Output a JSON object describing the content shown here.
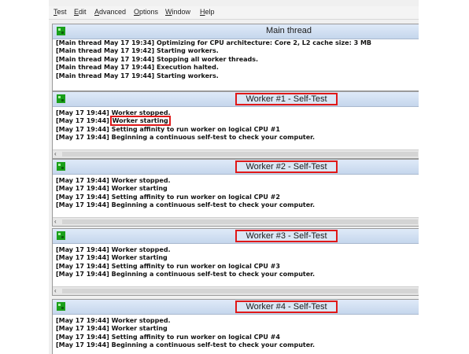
{
  "menu": [
    {
      "label": "Test",
      "mnemonic": "T",
      "rest": "est"
    },
    {
      "label": "Edit",
      "mnemonic": "E",
      "rest": "dit"
    },
    {
      "label": "Advanced",
      "mnemonic": "A",
      "rest": "dvanced"
    },
    {
      "label": "Options",
      "mnemonic": "O",
      "rest": "ptions"
    },
    {
      "label": "Window",
      "mnemonic": "W",
      "rest": "indow"
    },
    {
      "label": "Help",
      "mnemonic": "H",
      "rest": "elp"
    }
  ],
  "main_thread": {
    "title": "Main thread",
    "lines": [
      "[Main thread May 17 19:34] Optimizing for CPU architecture: Core 2, L2 cache size: 3 MB",
      "[Main thread May 17 19:42] Starting workers.",
      "[Main thread May 17 19:44] Stopping all worker threads.",
      "[Main thread May 17 19:44] Execution halted.",
      "[Main thread May 17 19:44] Starting workers."
    ]
  },
  "workers": [
    {
      "title": "Worker #1 - Self-Test",
      "lines": [
        {
          "ts": "[May 17 19:44]",
          "msg": "Worker stopped."
        },
        {
          "ts": "[May 17 19:44]",
          "msg": "Worker starting"
        },
        {
          "ts": "[May 17 19:44]",
          "msg": "Setting affinity to run worker on logical CPU #1"
        },
        {
          "ts": "[May 17 19:44]",
          "msg": "Beginning a continuous self-test to check your computer."
        }
      ]
    },
    {
      "title": "Worker #2 - Self-Test",
      "lines": [
        {
          "ts": "[May 17 19:44]",
          "msg": "Worker stopped."
        },
        {
          "ts": "[May 17 19:44]",
          "msg": "Worker starting"
        },
        {
          "ts": "[May 17 19:44]",
          "msg": "Setting affinity to run worker on logical CPU #2"
        },
        {
          "ts": "[May 17 19:44]",
          "msg": "Beginning a continuous self-test to check your computer."
        }
      ]
    },
    {
      "title": "Worker #3 - Self-Test",
      "lines": [
        {
          "ts": "[May 17 19:44]",
          "msg": "Worker stopped."
        },
        {
          "ts": "[May 17 19:44]",
          "msg": "Worker starting"
        },
        {
          "ts": "[May 17 19:44]",
          "msg": "Setting affinity to run worker on logical CPU #3"
        },
        {
          "ts": "[May 17 19:44]",
          "msg": "Beginning a continuous self-test to check your computer."
        }
      ]
    },
    {
      "title": "Worker #4 - Self-Test",
      "lines": [
        {
          "ts": "[May 17 19:44]",
          "msg": "Worker stopped."
        },
        {
          "ts": "[May 17 19:44]",
          "msg": "Worker starting"
        },
        {
          "ts": "[May 17 19:44]",
          "msg": "Setting affinity to run worker on logical CPU #4"
        },
        {
          "ts": "[May 17 19:44]",
          "msg": "Beginning a continuous self-test to check your computer."
        }
      ]
    }
  ],
  "scroll_left_glyph": "‹",
  "colors": {
    "highlight": "#e01818",
    "titlebar": "#c5d6ec",
    "icon": "#1aa01a"
  }
}
